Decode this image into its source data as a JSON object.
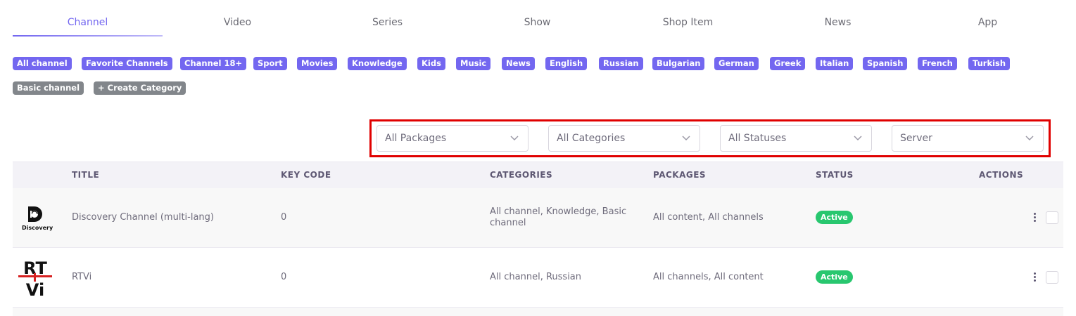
{
  "tabs": [
    {
      "label": "Channel",
      "active": true
    },
    {
      "label": "Video"
    },
    {
      "label": "Series"
    },
    {
      "label": "Show"
    },
    {
      "label": "Shop Item"
    },
    {
      "label": "News"
    },
    {
      "label": "App"
    }
  ],
  "categories": {
    "chips": [
      "All channel",
      "Favorite Channels",
      "Channel 18+",
      "Sport",
      "Movies",
      "Knowledge",
      "Kids",
      "Music",
      "News",
      "English",
      "Russian",
      "Bulgarian",
      "German",
      "Greek",
      "Italian",
      "Spanish",
      "French",
      "Turkish"
    ],
    "basic_chip": "Basic channel",
    "create_chip": "+ Create Category"
  },
  "filters": {
    "packages": "All Packages",
    "categories": "All Categories",
    "statuses": "All Statuses",
    "server": "Server"
  },
  "table": {
    "headers": {
      "title": "TITLE",
      "key_code": "KEY CODE",
      "categories": "CATEGORIES",
      "packages": "PACKAGES",
      "status": "STATUS",
      "actions": "ACTIONS"
    },
    "rows": [
      {
        "logo_text": "Discovery",
        "title": "Discovery Channel (multi-lang)",
        "key_code": "0",
        "categories_line1": "All channel, Knowledge, Basic",
        "categories_line2": "channel",
        "packages": "All content, All channels",
        "status": "Active"
      },
      {
        "logo_text": "RTVi",
        "title": "RTVi",
        "key_code": "0",
        "categories_line1": "All channel, Russian",
        "packages": "All channels, All content",
        "status": "Active"
      }
    ]
  },
  "colors": {
    "accent": "#7367f0",
    "success": "#28c76f",
    "highlight": "#e00000",
    "chip_gray": "#82868b"
  }
}
